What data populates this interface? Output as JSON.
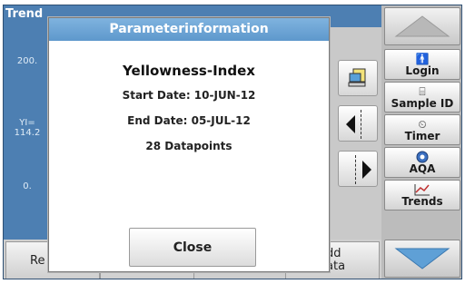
{
  "background": {
    "title": "Trend",
    "y_ticks": [
      "200.",
      "YI=\n114.2",
      "0."
    ],
    "bottom_left_label": "Re",
    "bottom_right_label": "dd\nata"
  },
  "side": {
    "login": "Login",
    "sample_id": "Sample ID",
    "timer": "Timer",
    "aqa": "AQA",
    "trends": "Trends"
  },
  "dialog": {
    "title": "Parameterinformation",
    "heading": "Yellowness-Index",
    "start_date": "Start Date: 10-JUN-12",
    "end_date": "End Date: 05-JUL-12",
    "datapoints": "28 Datapoints",
    "close_label": "Close"
  }
}
